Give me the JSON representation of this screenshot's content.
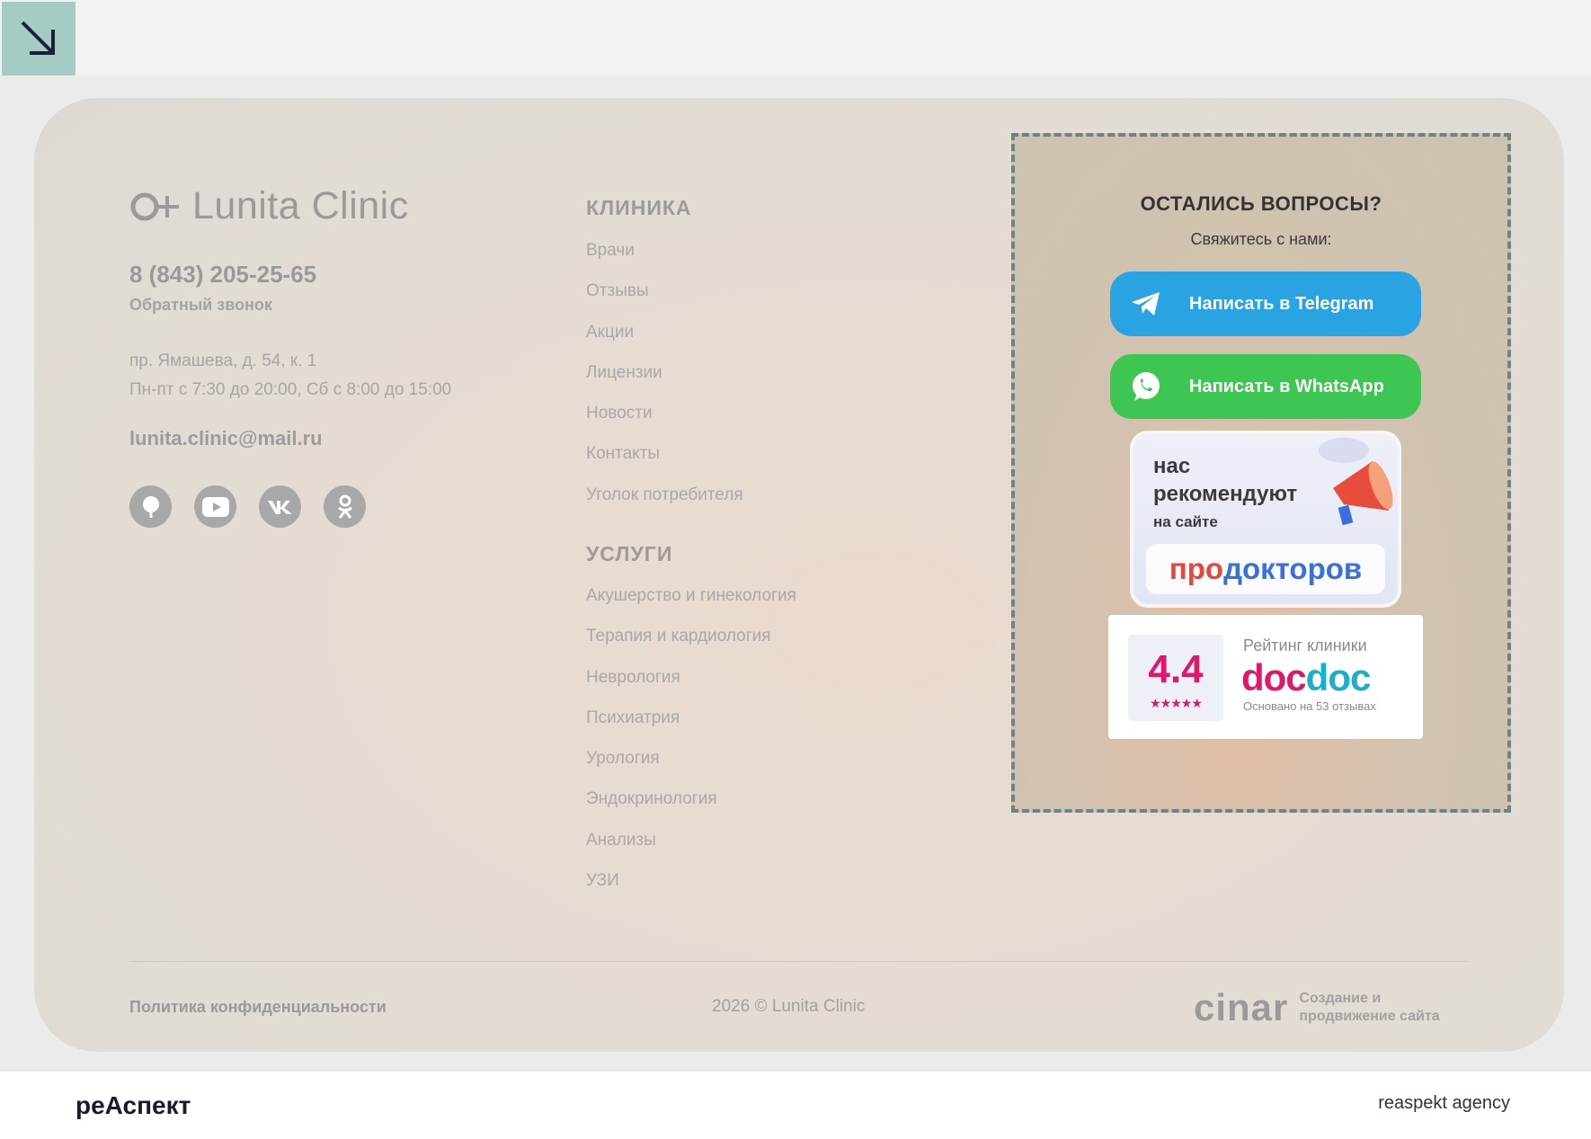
{
  "colors": {
    "accent_teal": "#a4ccc5",
    "telegram": "#2aa3e2",
    "whatsapp": "#3ec652",
    "docdoc_pink": "#e0186c",
    "prodoctorov_red": "#e6473c",
    "prodoctorov_blue": "#3a6fe0"
  },
  "header": {
    "arrow_icon": "arrow-down-right-icon"
  },
  "footer": {
    "logo_text": "Lunita Clinic",
    "phone": "8 (843) 205-25-65",
    "callback": "Обратный звонок",
    "address_line1": "пр. Ямашева, д. 54, к. 1",
    "address_line2": "Пн-пт с 7:30 до 20:00, Сб с 8:00 до 15:00",
    "email": "lunita.clinic@mail.ru",
    "socials": [
      "pin-icon",
      "youtube-icon",
      "vk-icon",
      "odnoklassniki-icon"
    ]
  },
  "clinic_menu": {
    "heading": "КЛИНИКА",
    "items": [
      "Врачи",
      "Отзывы",
      "Акции",
      "Лицензии",
      "Новости",
      "Контакты",
      "Уголок потребителя"
    ]
  },
  "services_menu": {
    "heading": "УСЛУГИ",
    "items": [
      "Акушерство и гинекология",
      "Терапия и кардиология",
      "Неврология",
      "Психиатрия",
      "Урология",
      "Эндокринология",
      "Анализы",
      "УЗИ"
    ]
  },
  "contact_box": {
    "title": "ОСТАЛИСЬ ВОПРОСЫ?",
    "subtitle": "Свяжитесь с нами:",
    "telegram_label": "Написать в Telegram",
    "whatsapp_label": "Написать в WhatsApp",
    "prodoctorov": {
      "line1": "нас",
      "line2": "рекомендуют",
      "line3": "на сайте",
      "logo_pro": "про",
      "logo_doc": "докторов"
    },
    "docdoc": {
      "score": "4.4",
      "stars": "★★★★★",
      "label": "Рейтинг клиники",
      "brand_a": "doc",
      "brand_b": "doc",
      "note": "Основано на 53 отзывах"
    }
  },
  "bottom": {
    "policy": "Политика конфиденциальности",
    "copyright": "2026 © Lunita Clinic",
    "cinar_logo": "cinar",
    "cinar_line1": "Создание и",
    "cinar_line2": "продвижение сайта"
  },
  "page_footer": {
    "left_brand": "реАспект",
    "right_brand": "reaspekt agency"
  }
}
